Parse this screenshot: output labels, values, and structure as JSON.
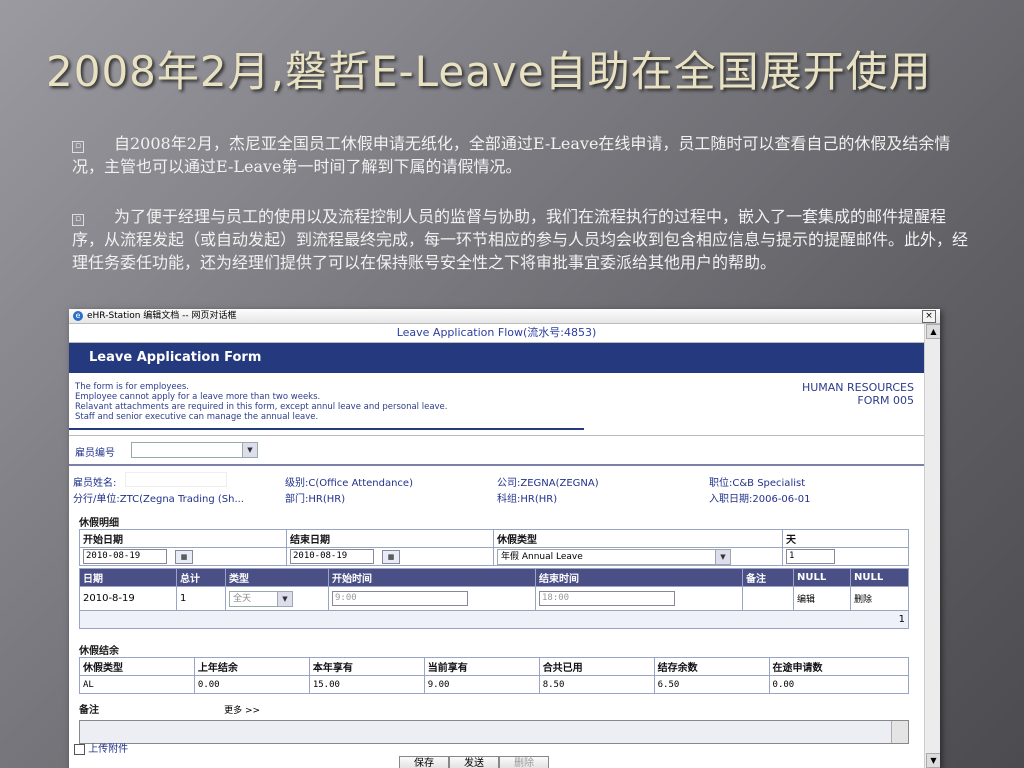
{
  "slide": {
    "title": "2008年2月,磐哲E-Leave自助在全国展开使用",
    "bullet_glyph": "▫",
    "para1": "自2008年2月，杰尼亚全国员工休假申请无纸化，全部通过E-Leave在线申请，员工随时可以查看自己的休假及结余情况，主管也可以通过E-Leave第一时间了解到下属的请假情况。",
    "para2": "为了便于经理与员工的使用以及流程控制人员的监督与协助，我们在流程执行的过程中，嵌入了一套集成的邮件提醒程序，从流程发起（或自动发起）到流程最终完成，每一环节相应的参与人员均会收到包含相应信息与提示的提醒邮件。此外，经理任务委任功能，还为经理们提供了可以在保持账号安全性之下将审批事宜委派给其他用户的帮助。"
  },
  "window": {
    "title": "eHR-Station 编辑文档 -- 网页对话框",
    "close": "×",
    "scroll_up": "▲",
    "scroll_down": "▼"
  },
  "form": {
    "flow": "Leave Application Flow(流水号:4853)",
    "header": "Leave Application Form",
    "notes": [
      "The form is for employees.",
      "Employee cannot apply for a leave more than two weeks.",
      "Relavant attachments are required in this form, except annul leave and personal leave.",
      "Staff and senior executive can manage the annual leave."
    ],
    "hr_line1": "HUMAN RESOURCES",
    "hr_line2": "FORM 005",
    "emp_no_label": "雇员编号",
    "emp_name_label": "雇员姓名:",
    "level": "级别:C(Office Attendance)",
    "company": "公司:ZEGNA(ZEGNA)",
    "position": "职位:C&B Specialist",
    "branch": "分行/单位:ZTC(Zegna Trading (Sh...",
    "dept": "部门:HR(HR)",
    "section": "科组:HR(HR)",
    "join_date": "入职日期:2006-06-01"
  },
  "leave_detail": {
    "title": "休假明细",
    "start_label": "开始日期",
    "end_label": "结束日期",
    "type_label": "休假类型",
    "days_label": "天",
    "start_value": "2010-08-19",
    "end_value": "2010-08-19",
    "type_value": "年假 Annual Leave",
    "days_value": "1",
    "headers": [
      "日期",
      "总计",
      "类型",
      "开始时间",
      "结束时间",
      "备注",
      "NULL",
      "NULL"
    ],
    "row": {
      "date": "2010-8-19",
      "total": "1",
      "type": "全天",
      "start_time": "9:00",
      "end_time": "18:00",
      "edit": "编辑",
      "delete": "删除"
    },
    "sum": "1"
  },
  "balance": {
    "title": "休假结余",
    "headers": [
      "休假类型",
      "上年结余",
      "本年享有",
      "当前享有",
      "合共已用",
      "结存余数",
      "在途申请数"
    ],
    "row": [
      "AL",
      "0.00",
      "15.00",
      "9.00",
      "8.50",
      "6.50",
      "0.00"
    ]
  },
  "remarks": {
    "label": "备注",
    "more": "更多 >>"
  },
  "attach_label": "上传附件",
  "buttons": {
    "save": "保存",
    "send": "发送",
    "delete": "删除"
  }
}
